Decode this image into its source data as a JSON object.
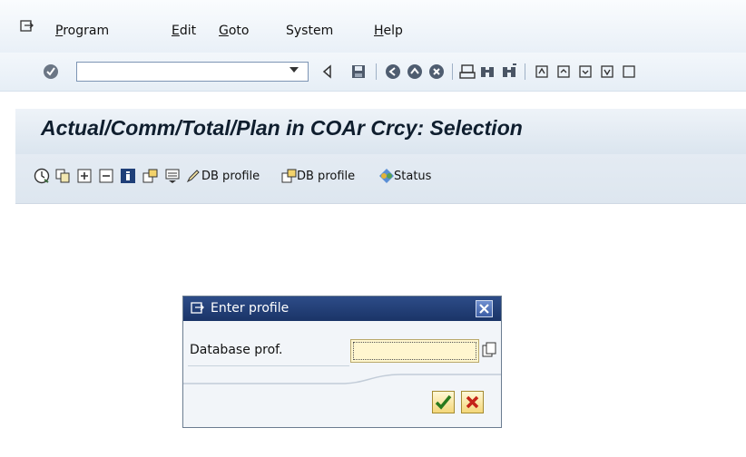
{
  "menubar": {
    "items": [
      {
        "label": "Program",
        "mnemonic": "P",
        "rest": "rogram"
      },
      {
        "label": "Edit",
        "mnemonic": "E",
        "rest": "dit"
      },
      {
        "label": "Goto",
        "mnemonic": "G",
        "rest": "oto"
      },
      {
        "label": "System",
        "mnemonic": "",
        "rest": "System"
      },
      {
        "label": "Help",
        "mnemonic": "H",
        "rest": "elp"
      }
    ]
  },
  "command_field": {
    "value": ""
  },
  "title": "Actual/Comm/Total/Plan in COAr Crcy: Selection",
  "app_toolbar": {
    "db_profile_1": "DB profile",
    "db_profile_2": "DB profile",
    "status": "Status"
  },
  "dialog": {
    "title": "Enter profile",
    "field_label": "Database prof.",
    "field_value": ""
  },
  "colors": {
    "dialog_title_bg": "#1a3467",
    "input_highlight": "#fff6cf",
    "title_text": "#0f1e2e"
  }
}
